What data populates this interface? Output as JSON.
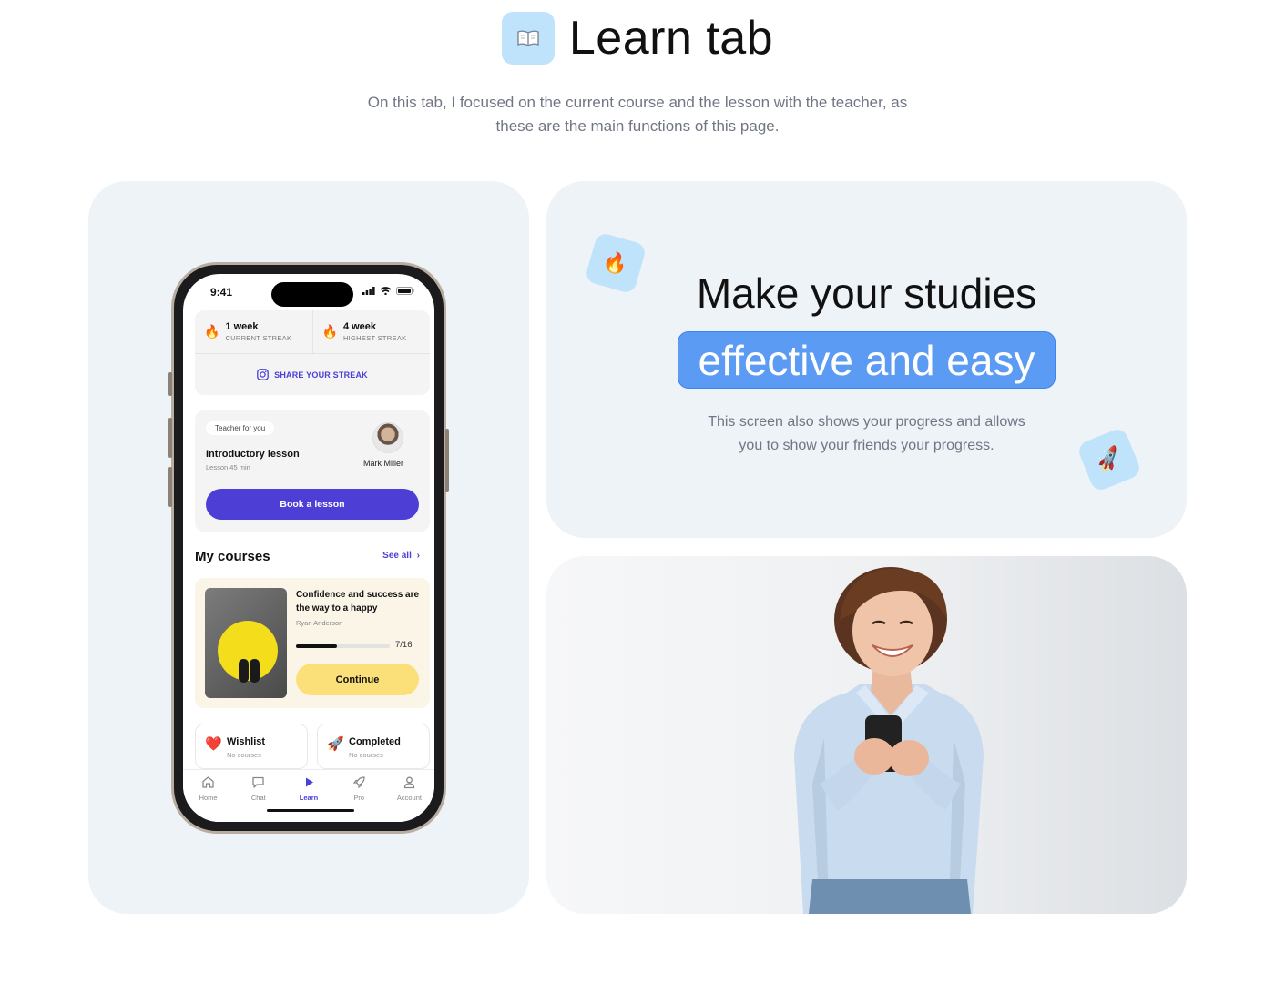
{
  "header": {
    "title": "Learn tab",
    "icon": "open-book-icon",
    "subtitle_line1": "On this tab, I focused on the current course and the lesson with the teacher, as",
    "subtitle_line2": "these are the main functions of this page."
  },
  "phone": {
    "status_time": "9:41",
    "streak": {
      "current_value": "1 week",
      "current_label": "CURRENT STREAK",
      "highest_value": "4 week",
      "highest_label": "HIGHEST STREAK",
      "share_label": "SHARE YOUR STREAK"
    },
    "teacher": {
      "chip": "Teacher for you",
      "lesson_title": "Introductory lesson",
      "lesson_meta": "Lesson 45 min",
      "teacher_name": "Mark Miller",
      "book_button": "Book a lesson"
    },
    "courses": {
      "title": "My courses",
      "see_all": "See all",
      "course_title": "Confidence and success are the way to a happy",
      "course_author": "Ryan Anderson",
      "progress_text": "7/16",
      "progress_value": 0.4375,
      "continue_button": "Continue"
    },
    "wishlist": {
      "title": "Wishlist",
      "sub": "No courses",
      "icon": "heart-icon"
    },
    "completed": {
      "title": "Completed",
      "sub": "No courses",
      "icon": "rocket-icon"
    },
    "tabs": [
      {
        "label": "Home",
        "icon": "home-icon"
      },
      {
        "label": "Chat",
        "icon": "chat-icon"
      },
      {
        "label": "Learn",
        "icon": "play-icon"
      },
      {
        "label": "Pro",
        "icon": "rocket-outline-icon"
      },
      {
        "label": "Account",
        "icon": "user-icon"
      }
    ],
    "active_tab": "Learn"
  },
  "promo": {
    "headline": "Make your studies",
    "highlight": "effective and easy",
    "sub_line1": "This screen also shows your progress and allows",
    "sub_line2": "you to show your friends your progress."
  },
  "colors": {
    "accent": "#4d3fd6",
    "highlight_bg": "#5c9bf3",
    "tile_bg": "#bfe3fb",
    "continue_bg": "#fbe079",
    "panel_bg": "#eef3f8"
  }
}
